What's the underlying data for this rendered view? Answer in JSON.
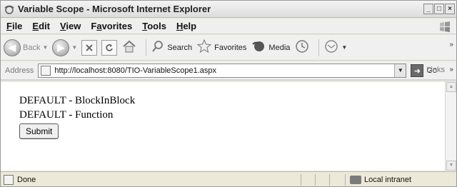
{
  "window": {
    "title": "Variable Scope - Microsoft Internet Explorer"
  },
  "menu": [
    {
      "label": "File",
      "key": "F",
      "rest": "ile"
    },
    {
      "label": "Edit",
      "key": "E",
      "rest": "dit"
    },
    {
      "label": "View",
      "key": "V",
      "rest": "iew"
    },
    {
      "label": "Favorites",
      "key": "a",
      "pre": "F",
      "rest": "vorites"
    },
    {
      "label": "Tools",
      "key": "T",
      "rest": "ools"
    },
    {
      "label": "Help",
      "key": "H",
      "rest": "elp"
    }
  ],
  "toolbar": {
    "back_label": "Back",
    "search_label": "Search",
    "favorites_label": "Favorites",
    "media_label": "Media"
  },
  "address": {
    "label": "Address",
    "url": "http://localhost:8080/TIO-VariableScope1.aspx",
    "go_label": "Go",
    "links_label": "Links"
  },
  "page": {
    "line1": "DEFAULT - BlockInBlock",
    "line2": "DEFAULT - Function",
    "submit_label": "Submit"
  },
  "status": {
    "text": "Done",
    "zone": "Local intranet"
  }
}
